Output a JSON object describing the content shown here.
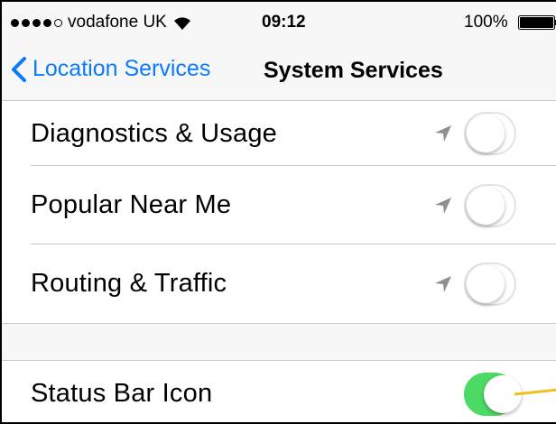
{
  "status_bar": {
    "carrier": "vodafone UK",
    "signal_bars_filled": 4,
    "signal_bars_total": 5,
    "time": "09:12",
    "battery_percent": "100%"
  },
  "nav_bar": {
    "back_label": "Location Services",
    "title": "System Services"
  },
  "settings_group_1": {
    "items": [
      {
        "label": "Diagnostics & Usage",
        "enabled": false,
        "icon": "location-arrow-icon"
      },
      {
        "label": "Popular Near Me",
        "enabled": false,
        "icon": "location-arrow-icon"
      },
      {
        "label": "Routing & Traffic",
        "enabled": false,
        "icon": "location-arrow-icon"
      }
    ]
  },
  "settings_group_2": {
    "items": [
      {
        "label": "Status Bar Icon",
        "enabled": true
      }
    ]
  },
  "colors": {
    "accent": "#0a7aff",
    "toggle_on": "#4cd964",
    "annotation": "#f0c020"
  }
}
